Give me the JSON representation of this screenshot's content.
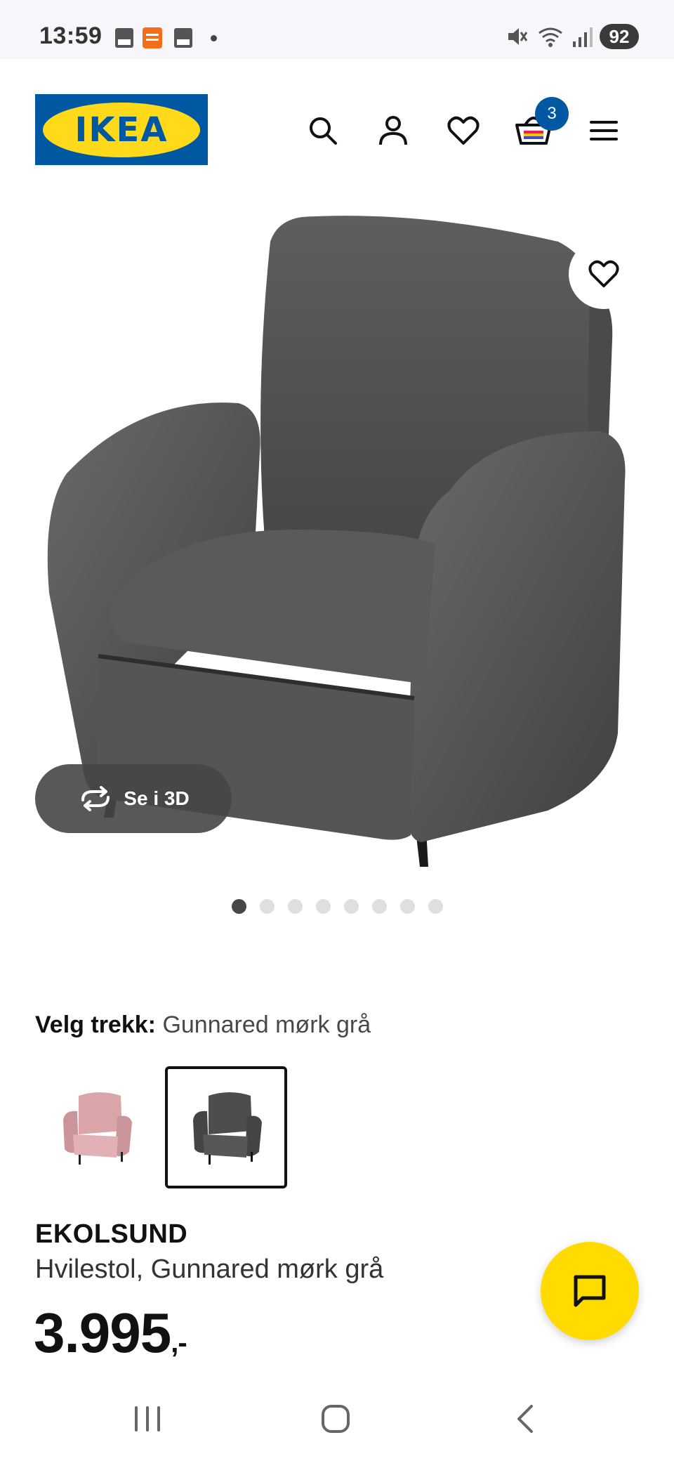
{
  "status_bar": {
    "time": "13:59",
    "battery": "92",
    "notification_icons": [
      "pdf-icon",
      "temu-icon",
      "pdf-icon"
    ],
    "system_icons": [
      "mute-icon",
      "wifi-icon",
      "signal-icon"
    ]
  },
  "header": {
    "logo_text": "IKEA",
    "cart_count": "3",
    "icons": [
      "search-icon",
      "account-icon",
      "heart-icon",
      "cart-icon",
      "menu-icon"
    ]
  },
  "product_image": {
    "view_3d_label": "Se i 3D",
    "carousel": {
      "total": 8,
      "active_index": 0
    }
  },
  "variant": {
    "label": "Velg trekk:",
    "value": "Gunnared mørk grå",
    "options": [
      {
        "name": "pink",
        "color": "#d9a5a9",
        "selected": false
      },
      {
        "name": "dark-grey",
        "color": "#4d4d4d",
        "selected": true
      }
    ]
  },
  "product": {
    "name": "EKOLSUND",
    "description": "Hvilestol, Gunnared mørk grå",
    "price": "3.995",
    "price_suffix": ",-"
  },
  "colors": {
    "brand_blue": "#0058a3",
    "brand_yellow": "#ffda1a",
    "chat_yellow": "#ffdb00"
  }
}
